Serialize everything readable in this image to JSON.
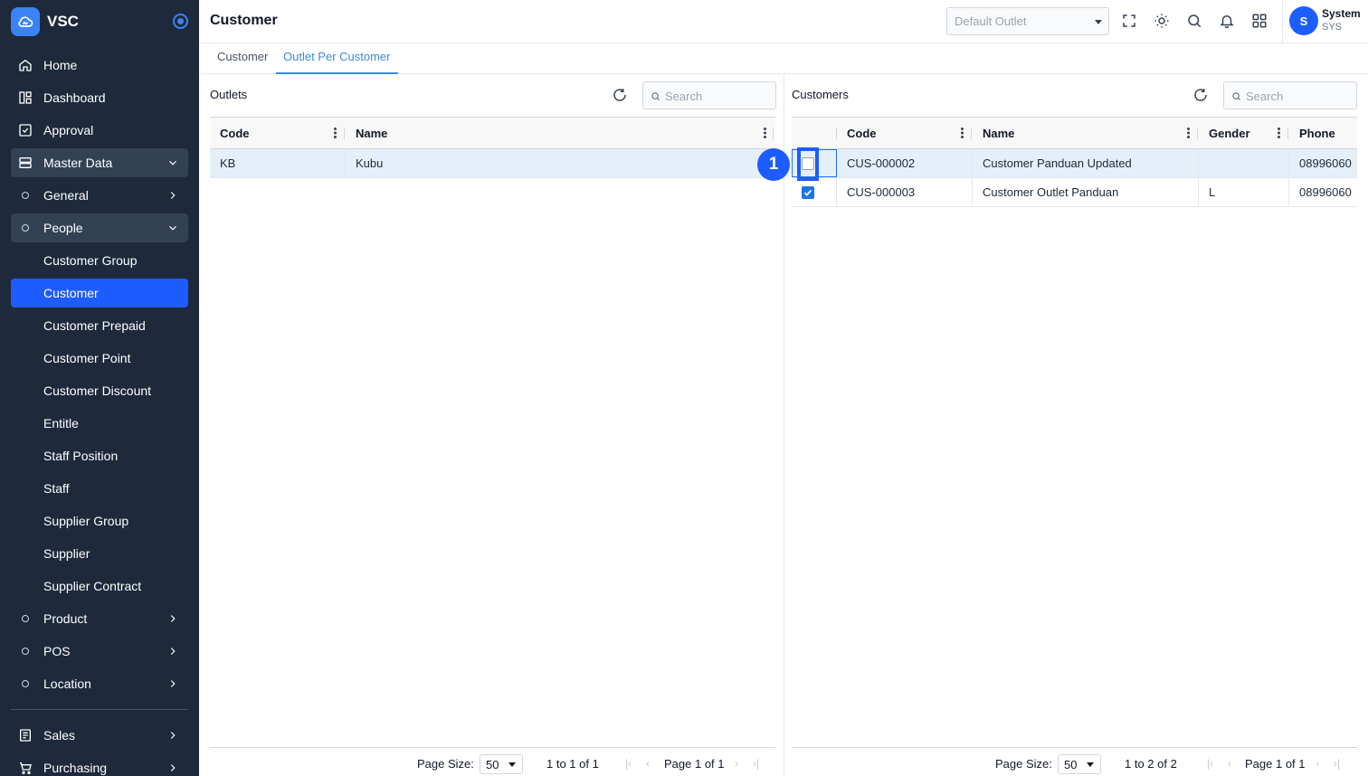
{
  "app": {
    "name": "VSC"
  },
  "sidebar": {
    "items": [
      {
        "label": "Home"
      },
      {
        "label": "Dashboard"
      },
      {
        "label": "Approval"
      },
      {
        "label": "Master Data"
      },
      {
        "label": "General"
      },
      {
        "label": "People"
      },
      {
        "label": "Customer Group"
      },
      {
        "label": "Customer"
      },
      {
        "label": "Customer Prepaid"
      },
      {
        "label": "Customer Point"
      },
      {
        "label": "Customer Discount"
      },
      {
        "label": "Entitle"
      },
      {
        "label": "Staff Position"
      },
      {
        "label": "Staff"
      },
      {
        "label": "Supplier Group"
      },
      {
        "label": "Supplier"
      },
      {
        "label": "Supplier Contract"
      },
      {
        "label": "Product"
      },
      {
        "label": "POS"
      },
      {
        "label": "Location"
      },
      {
        "label": "Sales"
      },
      {
        "label": "Purchasing"
      }
    ]
  },
  "header": {
    "title": "Customer",
    "outlet_placeholder": "Default Outlet",
    "user": {
      "initial": "S",
      "name": "System",
      "code": "SYS"
    }
  },
  "tabs": [
    {
      "label": "Customer"
    },
    {
      "label": "Outlet Per Customer"
    }
  ],
  "outlets": {
    "title": "Outlets",
    "search_placeholder": "Search",
    "columns": [
      "Code",
      "Name"
    ],
    "rows": [
      {
        "code": "KB",
        "name": "Kubu"
      }
    ],
    "footer": {
      "page_size_label": "Page Size:",
      "page_size": "50",
      "range": "1 to 1 of 1",
      "page": "Page 1 of 1"
    }
  },
  "customers": {
    "title": "Customers",
    "search_placeholder": "Search",
    "columns": [
      "Code",
      "Name",
      "Gender",
      "Phone"
    ],
    "rows": [
      {
        "checked": false,
        "code": "CUS-000002",
        "name": "Customer Panduan Updated",
        "gender": "",
        "phone": "08996060"
      },
      {
        "checked": true,
        "code": "CUS-000003",
        "name": "Customer Outlet Panduan",
        "gender": "L",
        "phone": "08996060"
      }
    ],
    "footer": {
      "page_size_label": "Page Size:",
      "page_size": "50",
      "range": "1 to 2 of 2",
      "page": "Page 1 of 1"
    }
  },
  "annotation": {
    "step": "1"
  },
  "colors": {
    "sidebar_bg": "#1e293b",
    "accent": "#1d5cff",
    "tab_active": "#3b8bdb",
    "row_selected": "#e4effa"
  }
}
